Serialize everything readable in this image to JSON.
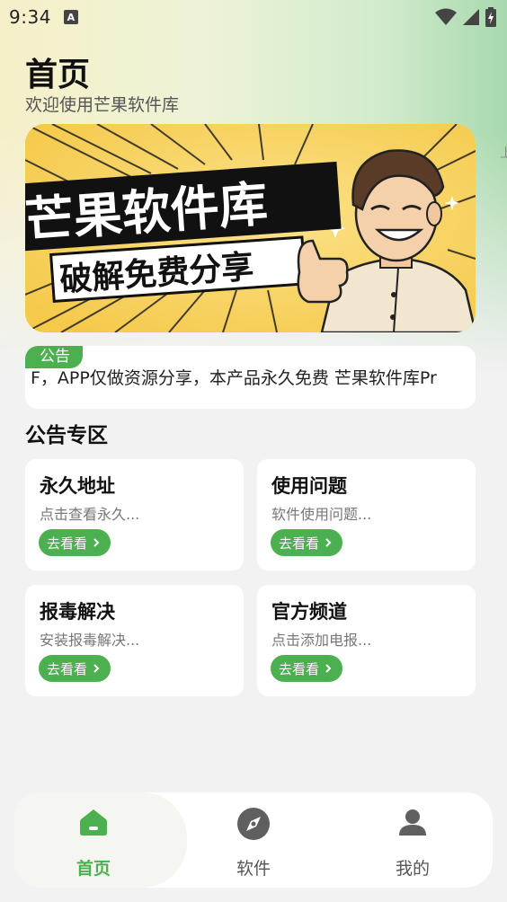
{
  "status_bar": {
    "time": "9:34",
    "notification_icon": "A"
  },
  "header": {
    "title": "首页",
    "subtitle": "欢迎使用芒果软件库"
  },
  "banner": {
    "line1": "芒果软件库",
    "line2": "破解免费分享"
  },
  "notice": {
    "tag": "公告",
    "text": "F，APP仅做资源分享，本产品永久免费    芒果软件库Pr"
  },
  "section": {
    "title": "公告专区"
  },
  "cards": [
    {
      "title": "永久地址",
      "desc": "点击查看永久...",
      "button": "去看看"
    },
    {
      "title": "使用问题",
      "desc": "软件使用问题...",
      "button": "去看看"
    },
    {
      "title": "报毒解决",
      "desc": "安装报毒解决...",
      "button": "去看看"
    },
    {
      "title": "官方频道",
      "desc": "点击添加电报...",
      "button": "去看看"
    }
  ],
  "nav": {
    "items": [
      {
        "label": "首页",
        "icon": "home-icon",
        "active": true
      },
      {
        "label": "软件",
        "icon": "compass-icon",
        "active": false
      },
      {
        "label": "我的",
        "icon": "user-icon",
        "active": false
      }
    ]
  },
  "colors": {
    "accent": "#4caf50",
    "background": "#f2f2f2",
    "banner_yellow": "#f8d56a"
  }
}
